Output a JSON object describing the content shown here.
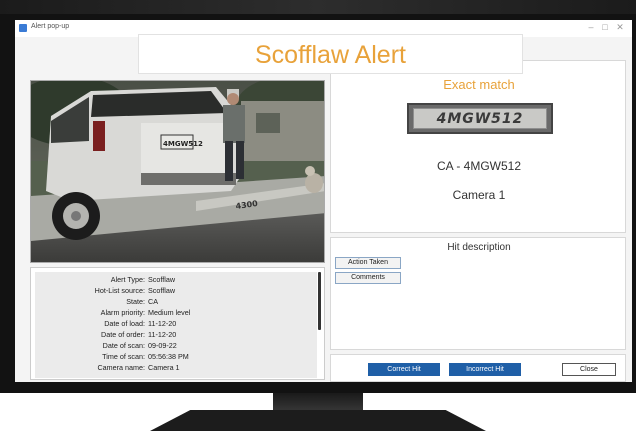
{
  "window": {
    "title": "Alert pop-up",
    "minimize_glyph": "–",
    "maximize_glyph": "□",
    "close_glyph": "✕"
  },
  "banner": {
    "title": "Scofflaw Alert"
  },
  "match": {
    "label": "Exact match",
    "plate_image_text": "4MGW512",
    "plate_id": "CA - 4MGW512",
    "camera": "Camera 1"
  },
  "photo": {
    "plate_text": "4MGW512",
    "curb_number": "4300"
  },
  "details": [
    {
      "label": "Alert Type:",
      "value": "Scofflaw"
    },
    {
      "label": "Hot-List source:",
      "value": "Scofflaw"
    },
    {
      "label": "State:",
      "value": "CA"
    },
    {
      "label": "Alarm priority:",
      "value": "Medium level"
    },
    {
      "label": "Date of load:",
      "value": "11-12-20"
    },
    {
      "label": "Date of order:",
      "value": "11-12-20"
    },
    {
      "label": "Date of scan:",
      "value": "09-09-22"
    },
    {
      "label": "Time of scan:",
      "value": "05:56:38 PM"
    },
    {
      "label": "Camera name:",
      "value": "Camera 1"
    }
  ],
  "hit": {
    "title": "Hit description",
    "action_taken": "Action Taken",
    "comments": "Comments"
  },
  "buttons": {
    "correct": "Correct Hit",
    "incorrect": "Incorrect Hit",
    "close": "Close"
  },
  "colors": {
    "accent": "#e8a23a",
    "button_blue": "#1f5fa7",
    "bezel": "#121212"
  }
}
